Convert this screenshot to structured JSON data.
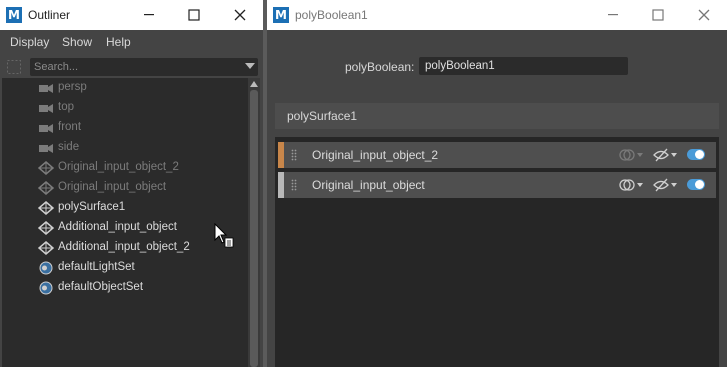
{
  "outliner": {
    "title": "Outliner",
    "menu": [
      "Display",
      "Show",
      "Help"
    ],
    "search_placeholder": "Search...",
    "items": [
      {
        "label": "persp",
        "type": "camera",
        "dim": true
      },
      {
        "label": "top",
        "type": "camera",
        "dim": true
      },
      {
        "label": "front",
        "type": "camera",
        "dim": true
      },
      {
        "label": "side",
        "type": "camera",
        "dim": true
      },
      {
        "label": "Original_input_object_2",
        "type": "mesh",
        "dim": true
      },
      {
        "label": "Original_input_object",
        "type": "mesh",
        "dim": true
      },
      {
        "label": "polySurface1",
        "type": "mesh",
        "dim": false
      },
      {
        "label": "Additional_input_object",
        "type": "mesh",
        "dim": false
      },
      {
        "label": "Additional_input_object_2",
        "type": "mesh",
        "dim": false
      },
      {
        "label": "defaultLightSet",
        "type": "set",
        "dim": false
      },
      {
        "label": "defaultObjectSet",
        "type": "set",
        "dim": false
      }
    ]
  },
  "editor": {
    "title": "polyBoolean1",
    "attr_label": "polyBoolean:",
    "attr_value": "polyBoolean1",
    "section_title": "polySurface1",
    "rows": [
      {
        "label": "Original_input_object_2",
        "color": "#c8864a",
        "enabled": true
      },
      {
        "label": "Original_input_object",
        "color": "#b8b8b8",
        "enabled": true
      }
    ]
  },
  "colors": {
    "accent_blue": "#4a9bd8",
    "maya_logo": "#1c6fb4"
  }
}
